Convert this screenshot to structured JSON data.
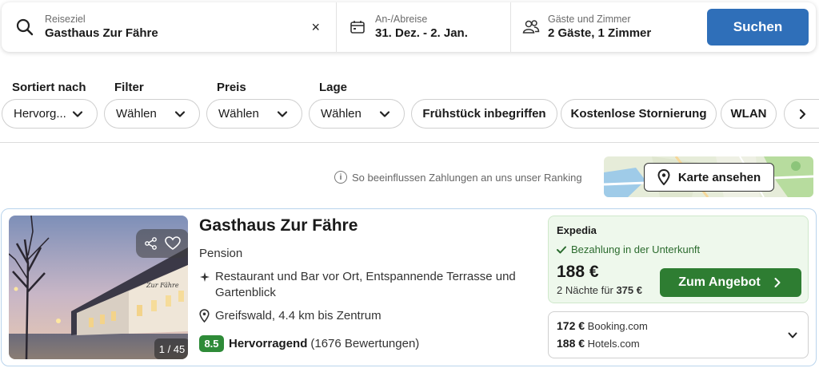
{
  "search": {
    "destination_label": "Reiseziel",
    "destination_value": "Gasthaus Zur Fähre",
    "clear_symbol": "×",
    "dates_label": "An-/Abreise",
    "dates_value": "31. Dez. - 2. Jan.",
    "guests_label": "Gäste und Zimmer",
    "guests_value": "2 Gäste, 1 Zimmer",
    "search_button": "Suchen",
    "icons": [
      "search-icon",
      "calendar-icon",
      "guests-icon",
      "close-icon"
    ]
  },
  "filters": {
    "sort_label": "Sortiert nach",
    "sort_value": "Hervorg...",
    "filter_label": "Filter",
    "filter_value": "Wählen",
    "price_label": "Preis",
    "price_value": "Wählen",
    "location_label": "Lage",
    "location_value": "Wählen",
    "chips": [
      "Frühstück inbegriffen",
      "Kostenlose Stornierung",
      "WLAN"
    ]
  },
  "ranking_info": "So beeinflussen Zahlungen an uns unser Ranking",
  "map_button": "Karte ansehen",
  "hotel": {
    "name": "Gasthaus Zur Fähre",
    "type": "Pension",
    "features": "Restaurant und Bar vor Ort, Entspannende Terrasse und Gartenblick",
    "location": "Greifswald, 4.4 km bis Zentrum",
    "score": "8.5",
    "rating_word": "Hervorragend",
    "reviews": "(1676 Bewertungen)",
    "photo_counter": "1 / 45",
    "photo_sign": "Zur Fähre"
  },
  "offer": {
    "provider": "Expedia",
    "payment": "Bezahlung in der Unterkunft",
    "price": "188 €",
    "nights_prefix": "2 Nächte für",
    "nights_total": "375 €",
    "button": "Zum Angebot"
  },
  "other_offers": [
    {
      "price": "172 €",
      "provider": "Booking.com"
    },
    {
      "price": "188 €",
      "provider": "Hotels.com"
    }
  ],
  "colors": {
    "search_button": "#2f6fb9",
    "deal_button": "#2e7d32",
    "score_badge": "#2e8b38",
    "offer_bg": "#eef8ec",
    "card_border": "#b9d4ec"
  }
}
